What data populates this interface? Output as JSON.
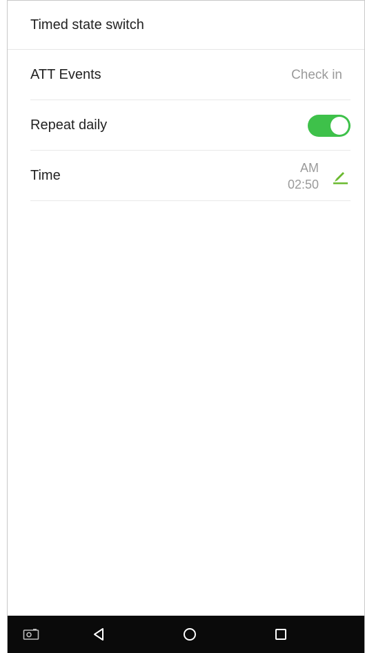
{
  "header": {
    "title": "Timed state switch"
  },
  "rows": {
    "att_events": {
      "label": "ATT Events",
      "value": "Check in"
    },
    "repeat_daily": {
      "label": "Repeat daily",
      "toggle_on": true
    },
    "time": {
      "label": "Time",
      "period": "AM",
      "value": "02:50"
    }
  },
  "navbar": {
    "icons": [
      "screenshot-icon",
      "back-icon",
      "home-icon",
      "recents-icon"
    ]
  },
  "colors": {
    "accent_green": "#3ec14a",
    "navbar_bg": "#0a0a0a",
    "secondary_text": "#9a9a9a"
  }
}
